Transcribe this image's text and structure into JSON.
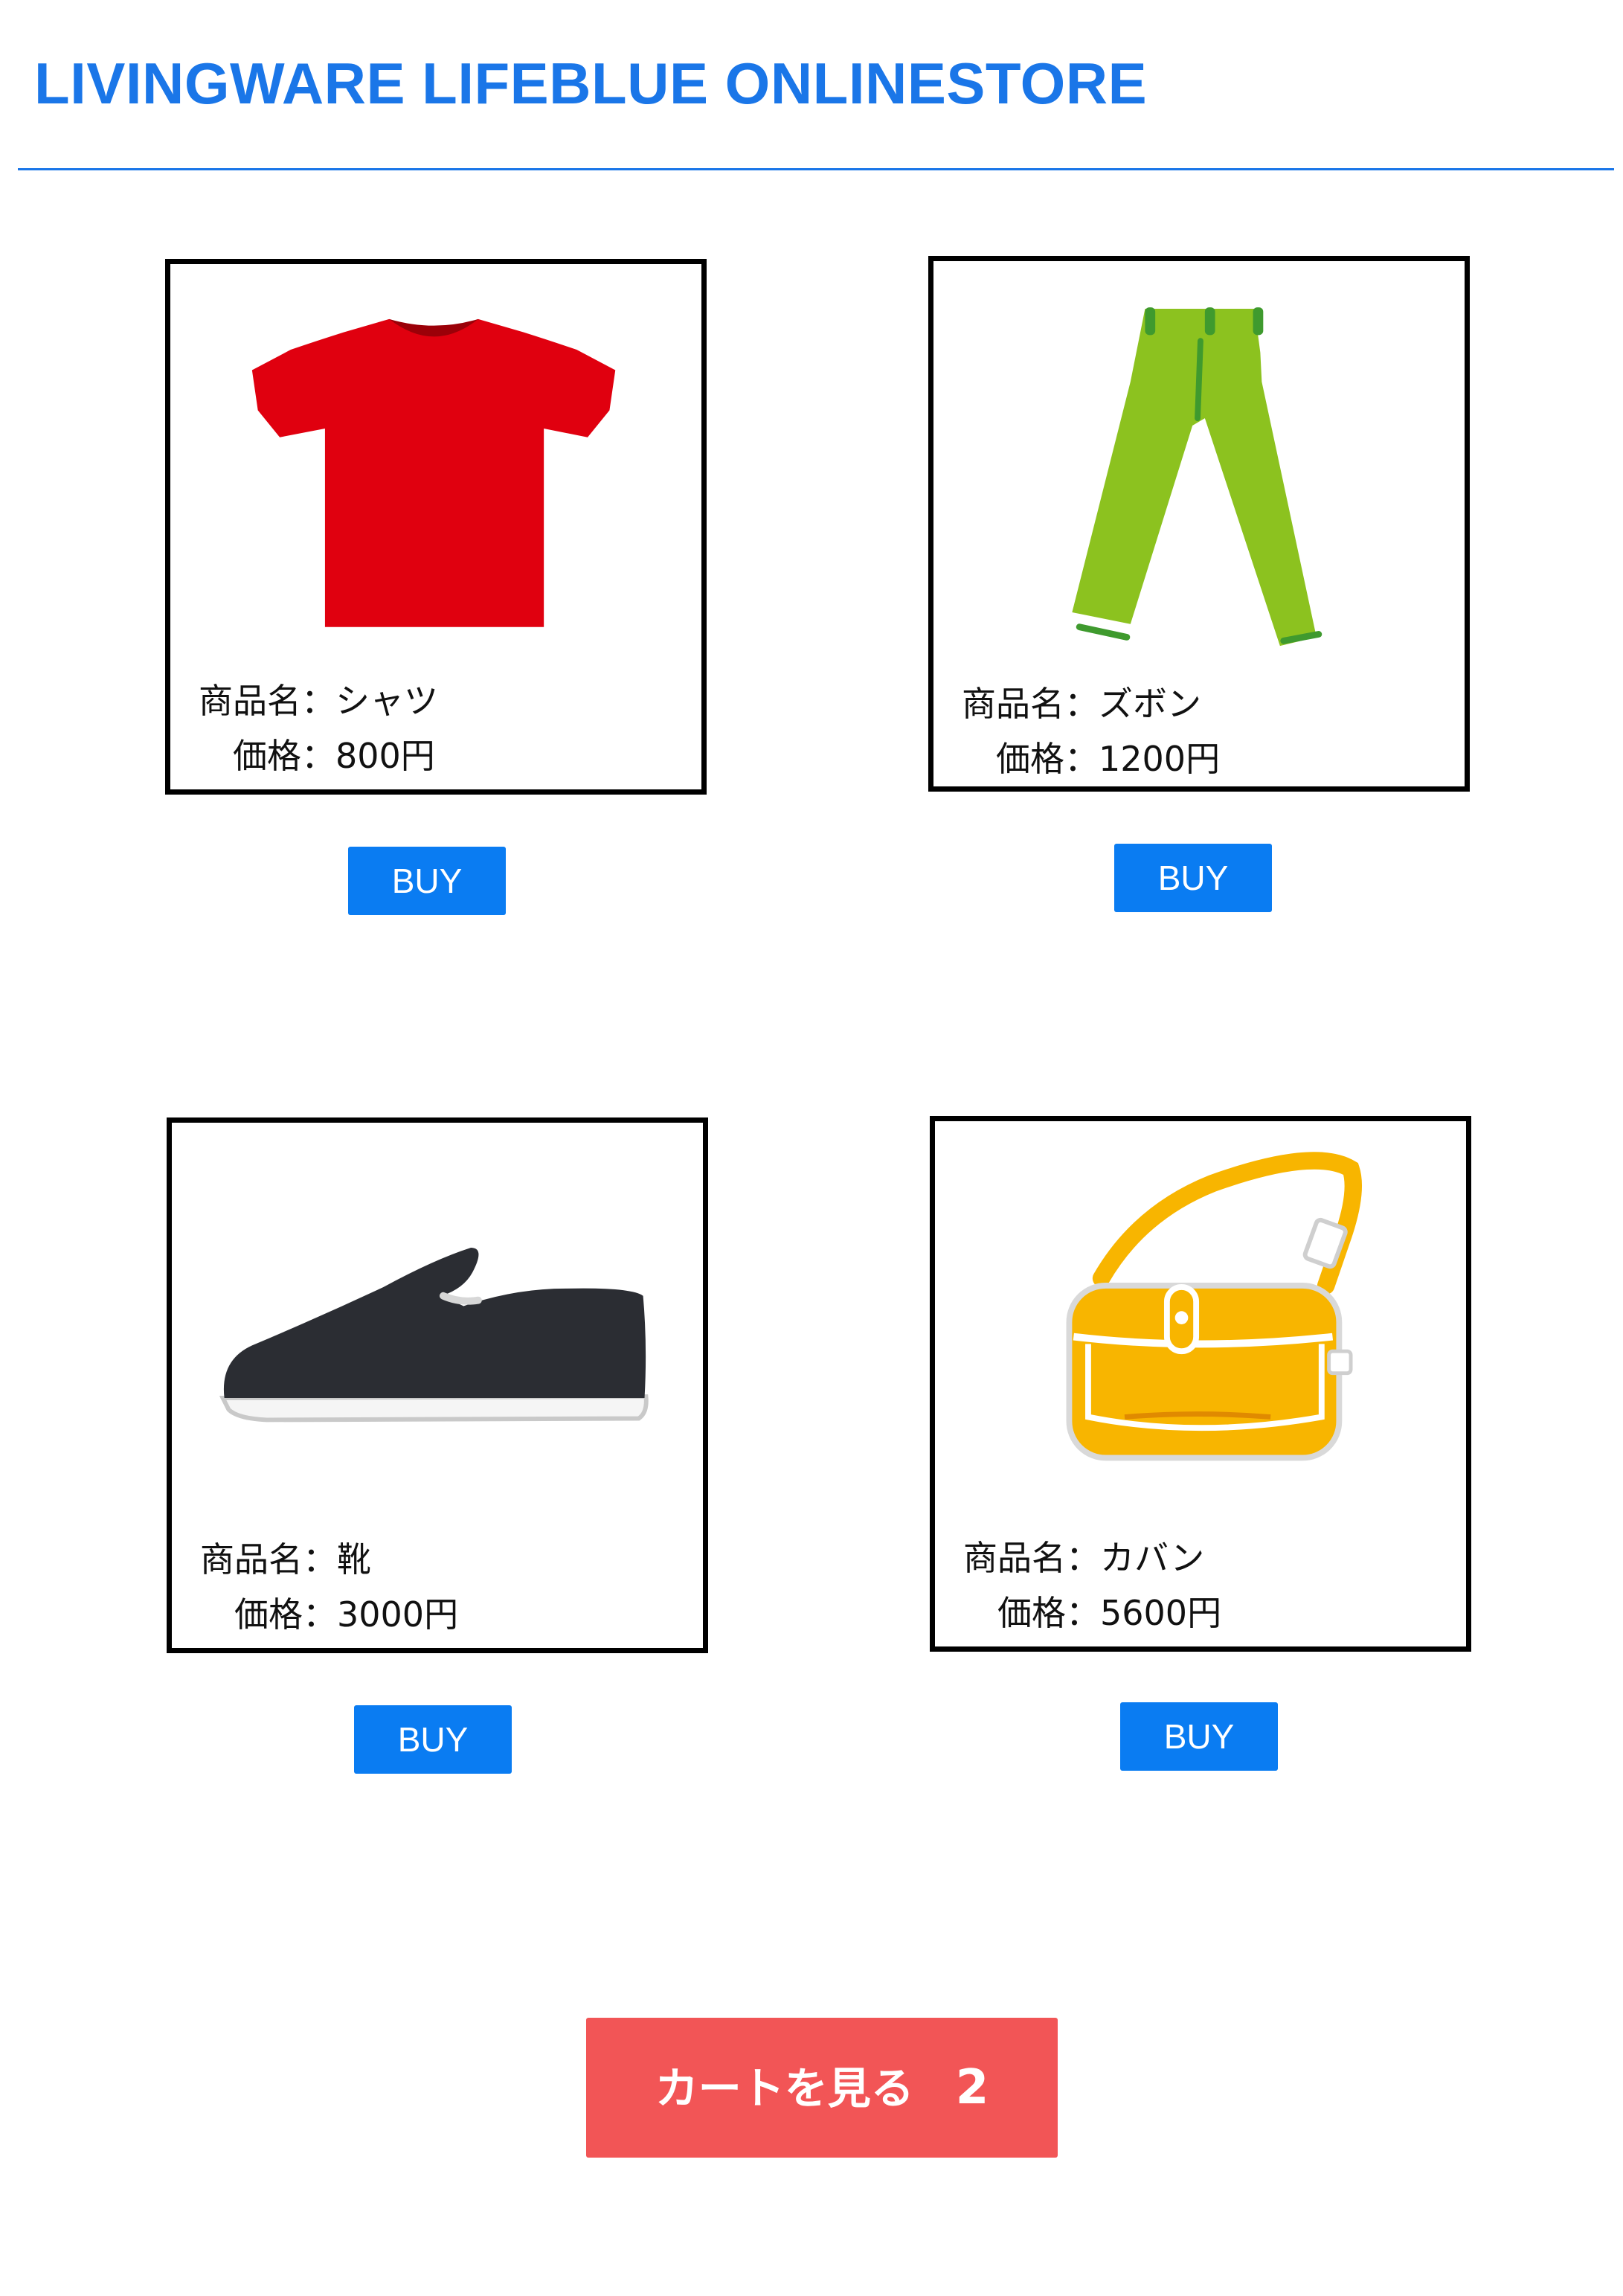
{
  "header": {
    "title": "LIVINGWARE LIFEBLUE ONLINESTORE"
  },
  "products": [
    {
      "name_label": "商品名：シャツ",
      "price_label": "価格：800円",
      "buy_label": "BUY",
      "icon": "t-shirt-icon",
      "color": "#e0000f"
    },
    {
      "name_label": "商品名：ズボン",
      "price_label": "価格：1200円",
      "buy_label": "BUY",
      "icon": "pants-icon",
      "color": "#8cc21f"
    },
    {
      "name_label": "商品名：靴",
      "price_label": "価格：3000円",
      "buy_label": "BUY",
      "icon": "shoe-icon",
      "color": "#2b2d33"
    },
    {
      "name_label": "商品名：カバン",
      "price_label": "価格：5600円",
      "buy_label": "BUY",
      "icon": "bag-icon",
      "color": "#f8b500"
    }
  ],
  "cart": {
    "label": "カートを見る",
    "count": "2"
  },
  "colors": {
    "accent": "#1a76e8",
    "buy_button": "#0a7cf2",
    "cart_button": "#f25556"
  }
}
